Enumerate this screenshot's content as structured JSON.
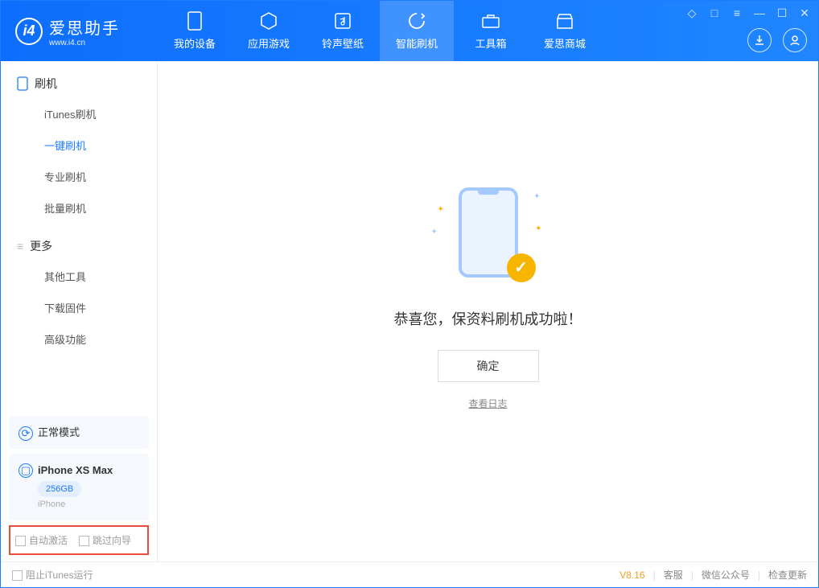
{
  "app": {
    "name_cn": "爱思助手",
    "url": "www.i4.cn"
  },
  "tabs": [
    {
      "label": "我的设备"
    },
    {
      "label": "应用游戏"
    },
    {
      "label": "铃声壁纸"
    },
    {
      "label": "智能刷机"
    },
    {
      "label": "工具箱"
    },
    {
      "label": "爱思商城"
    }
  ],
  "sidebar": {
    "section1": {
      "title": "刷机",
      "items": [
        "iTunes刷机",
        "一键刷机",
        "专业刷机",
        "批量刷机"
      ]
    },
    "section2": {
      "title": "更多",
      "items": [
        "其他工具",
        "下载固件",
        "高级功能"
      ]
    }
  },
  "mode": {
    "label": "正常模式"
  },
  "device": {
    "name": "iPhone XS Max",
    "storage": "256GB",
    "type": "iPhone"
  },
  "checks": {
    "auto_activate": "自动激活",
    "skip_guide": "跳过向导"
  },
  "main": {
    "message": "恭喜您，保资料刷机成功啦！",
    "ok": "确定",
    "view_log": "查看日志"
  },
  "footer": {
    "block_itunes": "阻止iTunes运行",
    "version": "V8.16",
    "service": "客服",
    "wechat": "微信公众号",
    "update": "检查更新"
  }
}
